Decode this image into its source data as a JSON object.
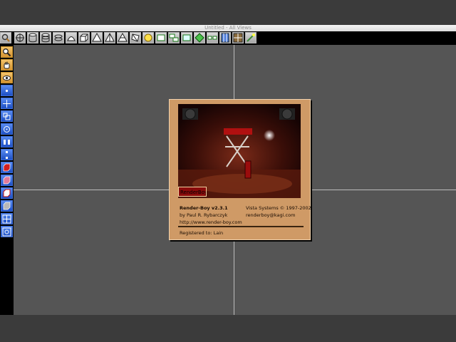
{
  "window": {
    "title": "Untitled - All Views"
  },
  "toolbar_top": {
    "items": [
      "zoom-icon",
      "rotate-view-icon",
      "cylinder-icon",
      "cylinder-alt-icon",
      "torus-icon",
      "cone-icon",
      "cube-icon",
      "pyramid-icon",
      "pyramid-alt-icon",
      "prism-icon",
      "polygon-icon",
      "sphere-light-icon",
      "box-view-icon",
      "camera-view-icon",
      "frame-view-icon",
      "diamond-icon",
      "split-view-icon",
      "texture-icon",
      "grid-view-icon",
      "render-icon"
    ]
  },
  "toolbar_left": {
    "items": [
      "magnify-icon",
      "hand-icon",
      "eye-icon",
      "move-point-icon",
      "move-axis-icon",
      "scale-icon",
      "rotate-point-icon",
      "align-icon",
      "distribute-icon",
      "red-cube-icon",
      "pink-cube-icon",
      "red-box-icon",
      "shaded-box-icon",
      "grid-icon",
      "grid-alt-icon"
    ]
  },
  "about": {
    "app_name": "Render-Boy v2.3.1",
    "author": "by Paul R. Rybarczyk",
    "url": "http://www.render-boy.com",
    "company": "Vista Systems © 1997-2002",
    "email": "renderboy@kagi.com",
    "registered": "Registered to: Lain",
    "logo_text": "RenderBoy"
  }
}
